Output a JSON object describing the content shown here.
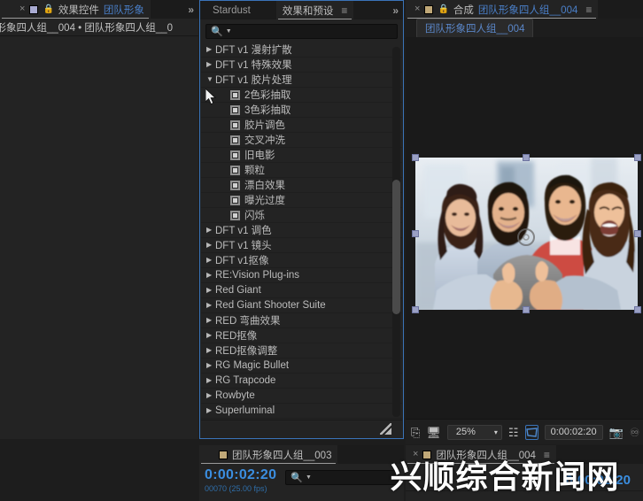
{
  "app": "Adobe After Effects",
  "effect_controls": {
    "tabs": [
      {
        "label": "效果控件",
        "highlight": "团队形象",
        "active": true,
        "icon": "lock-icon"
      }
    ],
    "close_label": "×",
    "overflow_label": "»",
    "breadcrumb": "队形象四人组__004 • 团队形象四人组__0"
  },
  "effects_panel": {
    "tabs": [
      {
        "label": "Stardust",
        "active": false
      },
      {
        "label": "效果和预设",
        "active": true
      }
    ],
    "menu_icon": "hamburger-icon",
    "overflow_label": "»",
    "search": {
      "value": "",
      "placeholder": "",
      "icon": "search-icon"
    },
    "items": [
      {
        "label": "DFT v1 漫射扩散",
        "type": "group",
        "expanded": false
      },
      {
        "label": "DFT v1 特殊效果",
        "type": "group",
        "expanded": false
      },
      {
        "label": "DFT v1 胶片处理",
        "type": "group",
        "expanded": true
      },
      {
        "label": "2色彩抽取",
        "type": "effect"
      },
      {
        "label": "3色彩抽取",
        "type": "effect"
      },
      {
        "label": "胶片调色",
        "type": "effect"
      },
      {
        "label": "交叉冲洗",
        "type": "effect"
      },
      {
        "label": "旧电影",
        "type": "effect"
      },
      {
        "label": "颗粒",
        "type": "effect"
      },
      {
        "label": "漂白效果",
        "type": "effect"
      },
      {
        "label": "曝光过度",
        "type": "effect"
      },
      {
        "label": "闪烁",
        "type": "effect"
      },
      {
        "label": "DFT v1 调色",
        "type": "group",
        "expanded": false
      },
      {
        "label": "DFT v1 镜头",
        "type": "group",
        "expanded": false
      },
      {
        "label": "DFT v1抠像",
        "type": "group",
        "expanded": false
      },
      {
        "label": "RE:Vision Plug-ins",
        "type": "group",
        "expanded": false
      },
      {
        "label": "Red Giant",
        "type": "group",
        "expanded": false
      },
      {
        "label": "Red Giant Shooter Suite",
        "type": "group",
        "expanded": false
      },
      {
        "label": "RED 弯曲效果",
        "type": "group",
        "expanded": false
      },
      {
        "label": "RED抠像",
        "type": "group",
        "expanded": false
      },
      {
        "label": "RED抠像调整",
        "type": "group",
        "expanded": false
      },
      {
        "label": "RG Magic Bullet",
        "type": "group",
        "expanded": false
      },
      {
        "label": "RG Trapcode",
        "type": "group",
        "expanded": false
      },
      {
        "label": "Rowbyte",
        "type": "group",
        "expanded": false
      },
      {
        "label": "Superluminal",
        "type": "group",
        "expanded": false
      }
    ],
    "collapsed_arrow": "▶",
    "expanded_arrow": "▼",
    "resize_grip": "resize-grip-icon"
  },
  "composition": {
    "tabs": [
      {
        "close": "×",
        "label": "合成",
        "name": "团队形象四人组__004",
        "active": true
      }
    ],
    "menu_icon": "hamburger-icon",
    "breadcrumb": "团队形象四人组__004",
    "toolbar": {
      "always_preview_icon": "always-preview-icon",
      "monitor_icon": "monitor-icon",
      "zoom_value": "25%",
      "zoom_caret": "▾",
      "resolution_icon": "resolution-icon",
      "region_of_interest_icon": "region-of-interest-icon",
      "timecode": "0:00:02:20",
      "snapshot_icon": "camera-icon",
      "show_snapshot_icon": "show-snapshot-icon"
    }
  },
  "timeline_left": {
    "tabs": [
      {
        "label": "团队形象四人组__003",
        "active": true
      }
    ],
    "timecode": "0:00:02:20",
    "frame_info": "00070 (25.00 fps)",
    "search": {
      "value": "",
      "placeholder": "",
      "icon": "search-icon"
    }
  },
  "timeline_right": {
    "tabs": [
      {
        "close": "×",
        "label": "团队形象四人组__004",
        "active": true
      }
    ],
    "menu_icon": "hamburger-icon",
    "timecode": "0:00:02:20"
  },
  "watermark": {
    "text": "兴顺综合新闻网"
  },
  "colors": {
    "accent_blue": "#3b8ee0",
    "panel_bg": "#232323",
    "tabbar_bg": "#1b1b1b",
    "border_focus": "#3a73b8",
    "text": "#c8c8c8"
  }
}
